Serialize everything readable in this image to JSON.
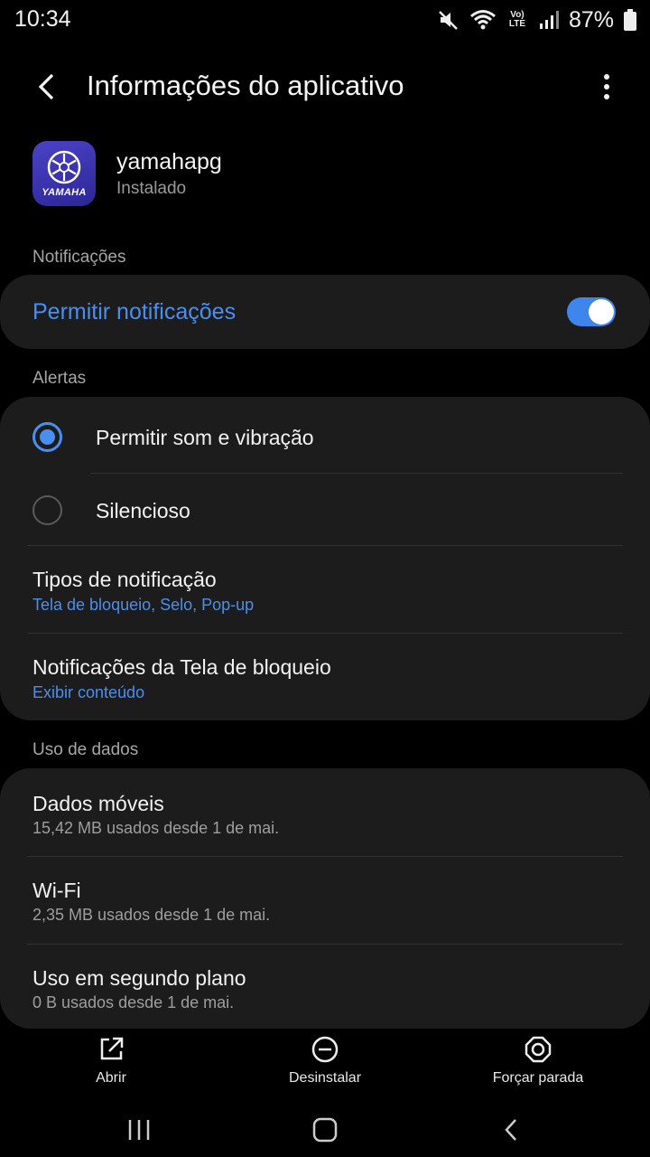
{
  "status_bar": {
    "time": "10:34",
    "network_label": "Vo) LTE",
    "battery": "87%",
    "icons": [
      "mute-icon",
      "wifi-icon",
      "volte-icon",
      "signal-icon",
      "battery-icon"
    ]
  },
  "appbar": {
    "title": "Informações do aplicativo"
  },
  "app": {
    "name": "yamahapg",
    "status": "Instalado",
    "icon_text": "YAMAHA",
    "icon_color": "#3b34b5"
  },
  "notifications": {
    "section_label": "Notificações",
    "allow_label": "Permitir notificações",
    "allow_enabled": true
  },
  "alerts": {
    "section_label": "Alertas",
    "options": [
      {
        "label": "Permitir som e vibração",
        "selected": true
      },
      {
        "label": "Silencioso",
        "selected": false
      }
    ],
    "notification_types": {
      "title": "Tipos de notificação",
      "value": "Tela de bloqueio, Selo, Pop-up"
    },
    "lock_screen": {
      "title": "Notificações da Tela de bloqueio",
      "value": "Exibir conteúdo"
    }
  },
  "data_usage": {
    "section_label": "Uso de dados",
    "items": [
      {
        "title": "Dados móveis",
        "value": "15,42 MB usados desde 1 de mai."
      },
      {
        "title": "Wi-Fi",
        "value": "2,35 MB usados desde 1 de mai."
      },
      {
        "title": "Uso em segundo plano",
        "value": "0 B usados desde 1 de mai."
      }
    ]
  },
  "actions": {
    "open": "Abrir",
    "uninstall": "Desinstalar",
    "force_stop": "Forçar parada"
  },
  "colors": {
    "accent": "#4a8ff0",
    "card": "#1c1c1c",
    "background": "#000000"
  }
}
